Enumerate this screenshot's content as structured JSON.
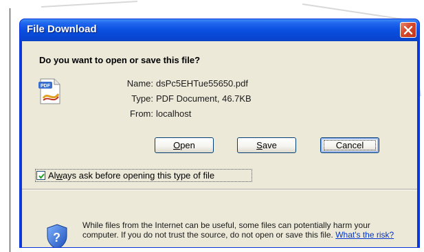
{
  "window": {
    "title": "File Download"
  },
  "dialog": {
    "heading": "Do you want to open or save this file?",
    "file_info": {
      "name_label": "Name:",
      "name_value": "dsPc5EHTue55650.pdf",
      "type_label": "Type:",
      "type_value": "PDF Document, 46.7KB",
      "from_label": "From:",
      "from_value": "localhost"
    },
    "buttons": {
      "open_prefix": "",
      "open_mnemonic": "O",
      "open_rest": "pen",
      "save_prefix": "",
      "save_mnemonic": "S",
      "save_rest": "ave",
      "cancel": "Cancel"
    },
    "checkbox": {
      "label_prefix": "Al",
      "label_mnemonic": "w",
      "label_rest": "ays ask before opening this type of file",
      "checked": true
    },
    "warning": {
      "text": "While files from the Internet can be useful, some files can potentially harm your computer. If you do not trust the source, do not open or save this file. ",
      "link": "What's the risk?"
    }
  },
  "icons": {
    "pdf": "pdf-file-icon",
    "shield": "shield-question-icon",
    "close": "close-icon",
    "check": "checkmark-icon"
  },
  "colors": {
    "titlebar": "#0a4fe0",
    "client_bg": "#ece9d8",
    "close_button": "#d6482a",
    "link": "#0033cc"
  }
}
